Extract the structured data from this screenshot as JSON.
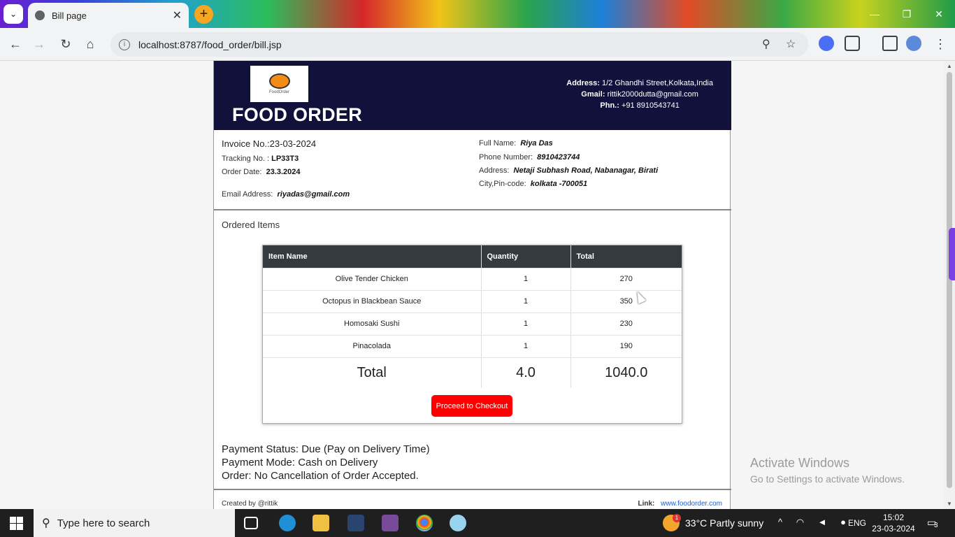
{
  "browser": {
    "tab_title": "Bill page",
    "url": "localhost:8787/food_order/bill.jsp"
  },
  "header": {
    "logo_text": "FoodOrder",
    "brand": "FOOD ORDER",
    "address_label": "Address:",
    "address": "1/2 Ghandhi Street,Kolkata,India",
    "gmail_label": "Gmail:",
    "gmail": "rittik2000dutta@gmail.com",
    "phone_label": "Phn.:",
    "phone": "+91 8910543741"
  },
  "invoice": {
    "invoice_label": "Invoice No.:",
    "invoice_no": "23-03-2024",
    "tracking_label": "Tracking No. :",
    "tracking_no": "LP33T3",
    "date_label": "Order Date:",
    "date": "23.3.2024",
    "email_label": "Email Address:",
    "email": "riyadas@gmail.com"
  },
  "customer": {
    "name_label": "Full Name:",
    "name": "Riya Das",
    "phone_label": "Phone Number:",
    "phone": "8910423744",
    "address_label": "Address:",
    "address": "Netaji Subhash Road, Nabanagar, Birati",
    "city_label": "City,Pin-code:",
    "city": "kolkata -700051"
  },
  "ordered_title": "Ordered Items",
  "table": {
    "headers": [
      "Item Name",
      "Quantity",
      "Total"
    ],
    "rows": [
      [
        "Olive Tender Chicken",
        "1",
        "270"
      ],
      [
        "Octopus in Blackbean Sauce",
        "1",
        "350"
      ],
      [
        "Homosaki Sushi",
        "1",
        "230"
      ],
      [
        "Pinacolada",
        "1",
        "190"
      ]
    ],
    "total_label": "Total",
    "total_qty": "4.0",
    "total_amount": "1040.0"
  },
  "checkout_label": "Proceed to Checkout",
  "status": {
    "payment_status": "Payment Status: Due (Pay on Delivery Time)",
    "payment_mode": "Payment Mode: Cash on Delivery",
    "order_note": "Order: No Cancellation of Order Accepted."
  },
  "footer": {
    "created": "Created by @rittik",
    "link_label": "Link:",
    "link": "www.foodorder.com"
  },
  "watermark": {
    "line1": "Activate Windows",
    "line2": "Go to Settings to activate Windows."
  },
  "taskbar": {
    "search_placeholder": "Type here to search",
    "weather": "33°C  Partly sunny",
    "lang": "ENG",
    "time": "15:02",
    "date": "23-03-2024",
    "notifications": "3",
    "weather_badge": "1"
  }
}
